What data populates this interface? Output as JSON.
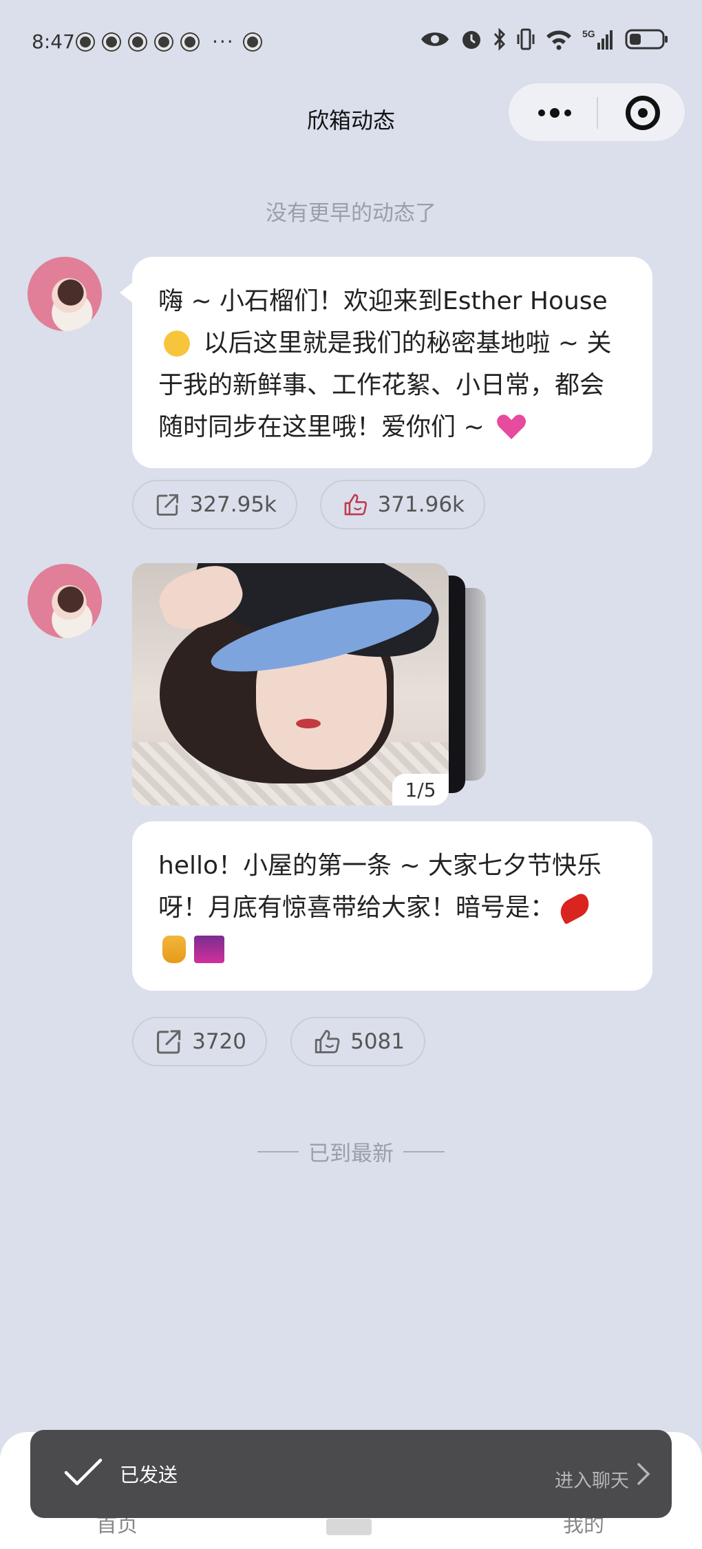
{
  "status_bar": {
    "time": "8:47",
    "more": "···",
    "network": "5G",
    "icons": [
      "eye-icon",
      "alarm-icon",
      "bluetooth-icon",
      "vibrate-icon",
      "wifi-icon",
      "signal-icon",
      "battery-icon"
    ]
  },
  "header": {
    "title": "欣箱动态",
    "capsule": {
      "more": "more-icon",
      "close": "close-target-icon"
    }
  },
  "feed": {
    "top_notice": "没有更早的动态了",
    "posts": [
      {
        "text": "嗨 ~ 小石榴们！欢迎来到Esther House 🥳 以后这里就是我们的秘密基地啦 ~ 关于我的新鲜事、工作花絮、小日常，都会随时同步在这里哦！爱你们 ~ 💖",
        "text_parts": [
          "嗨 ~ 小石榴们！欢迎来到Esther House",
          " 以后这里就是我们的秘密基地啦 ~ 关于我的新鲜事、工作花絮、小日常，都会随时同步在这里哦！爱你们 ~ "
        ],
        "share_count": "327.95k",
        "like_count": "371.96k",
        "liked": true
      },
      {
        "image_counter": "1/5",
        "text": "hello！小屋的第一条 ~  大家七夕节快乐呀！月底有惊喜带给大家！暗号是：🌶 🍯 🌆",
        "text_parts": [
          "hello！小屋的第一条 ~  大家七夕节快乐呀！月底有惊喜带给大家！暗号是："
        ],
        "share_count": "3720",
        "like_count": "5081",
        "liked": false
      }
    ],
    "bottom_notice": "已到最新"
  },
  "tabbar": {
    "left": "首页",
    "right": "我的"
  },
  "toast": {
    "message": "已发送",
    "link": "进入聊天"
  },
  "colors": {
    "background": "#dadfeb",
    "like_active": "#c0394f",
    "toast": "#4b4b4d"
  }
}
